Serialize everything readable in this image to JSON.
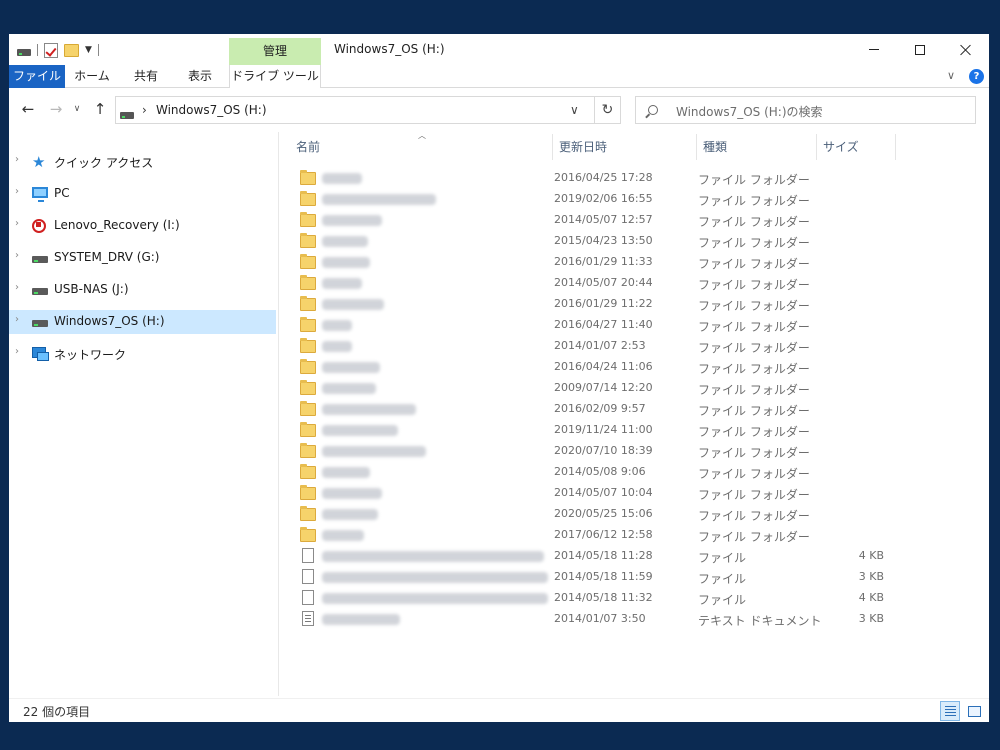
{
  "window": {
    "title": "Windows7_OS (H:)",
    "context_tab": "管理"
  },
  "ribbon": {
    "tabs": [
      "ファイル",
      "ホーム",
      "共有",
      "表示",
      "ドライブ ツール"
    ],
    "help": "?"
  },
  "address": {
    "path": "Windows7_OS (H:)",
    "search_placeholder": "Windows7_OS (H:)の検索"
  },
  "nav": {
    "items": [
      {
        "label": "クイック アクセス",
        "icon": "quick-access-star-icon"
      },
      {
        "label": "PC",
        "icon": "pc-icon"
      },
      {
        "label": "Lenovo_Recovery (I:)",
        "icon": "recovery-drive-icon"
      },
      {
        "label": "SYSTEM_DRV (G:)",
        "icon": "drive-icon"
      },
      {
        "label": "USB-NAS (J:)",
        "icon": "drive-icon"
      },
      {
        "label": "Windows7_OS (H:)",
        "icon": "drive-icon",
        "selected": true
      },
      {
        "label": "ネットワーク",
        "icon": "network-icon"
      }
    ]
  },
  "columns": {
    "name": "名前",
    "date": "更新日時",
    "type": "種類",
    "size": "サイズ"
  },
  "files": [
    {
      "kind": "folder",
      "date": "2016/04/25 17:28",
      "type": "ファイル フォルダー",
      "size": ""
    },
    {
      "kind": "folder",
      "date": "2019/02/06 16:55",
      "type": "ファイル フォルダー",
      "size": ""
    },
    {
      "kind": "folder",
      "date": "2014/05/07 12:57",
      "type": "ファイル フォルダー",
      "size": ""
    },
    {
      "kind": "folder",
      "date": "2015/04/23 13:50",
      "type": "ファイル フォルダー",
      "size": ""
    },
    {
      "kind": "folder",
      "date": "2016/01/29 11:33",
      "type": "ファイル フォルダー",
      "size": ""
    },
    {
      "kind": "folder",
      "date": "2014/05/07 20:44",
      "type": "ファイル フォルダー",
      "size": ""
    },
    {
      "kind": "folder",
      "date": "2016/01/29 11:22",
      "type": "ファイル フォルダー",
      "size": ""
    },
    {
      "kind": "folder",
      "date": "2016/04/27 11:40",
      "type": "ファイル フォルダー",
      "size": ""
    },
    {
      "kind": "folder",
      "date": "2014/01/07 2:53",
      "type": "ファイル フォルダー",
      "size": ""
    },
    {
      "kind": "folder",
      "date": "2016/04/24 11:06",
      "type": "ファイル フォルダー",
      "size": ""
    },
    {
      "kind": "folder",
      "date": "2009/07/14 12:20",
      "type": "ファイル フォルダー",
      "size": ""
    },
    {
      "kind": "folder",
      "date": "2016/02/09 9:57",
      "type": "ファイル フォルダー",
      "size": ""
    },
    {
      "kind": "folder",
      "date": "2019/11/24 11:00",
      "type": "ファイル フォルダー",
      "size": ""
    },
    {
      "kind": "folder",
      "date": "2020/07/10 18:39",
      "type": "ファイル フォルダー",
      "size": ""
    },
    {
      "kind": "folder",
      "date": "2014/05/08 9:06",
      "type": "ファイル フォルダー",
      "size": ""
    },
    {
      "kind": "folder",
      "date": "2014/05/07 10:04",
      "type": "ファイル フォルダー",
      "size": ""
    },
    {
      "kind": "folder",
      "date": "2020/05/25 15:06",
      "type": "ファイル フォルダー",
      "size": ""
    },
    {
      "kind": "folder",
      "date": "2017/06/12 12:58",
      "type": "ファイル フォルダー",
      "size": ""
    },
    {
      "kind": "file",
      "date": "2014/05/18 11:28",
      "type": "ファイル",
      "size": "4 KB"
    },
    {
      "kind": "file",
      "date": "2014/05/18 11:59",
      "type": "ファイル",
      "size": "3 KB"
    },
    {
      "kind": "file",
      "date": "2014/05/18 11:32",
      "type": "ファイル",
      "size": "4 KB"
    },
    {
      "kind": "text",
      "date": "2014/01/07 3:50",
      "type": "テキスト ドキュメント",
      "size": "3 KB"
    }
  ],
  "status": {
    "item_count": "22 個の項目"
  },
  "colors": {
    "file_tab": "#1a64c4",
    "context_tab": "#c9ecb0",
    "selection": "#cce8ff",
    "desktop": "#0b2a52"
  }
}
